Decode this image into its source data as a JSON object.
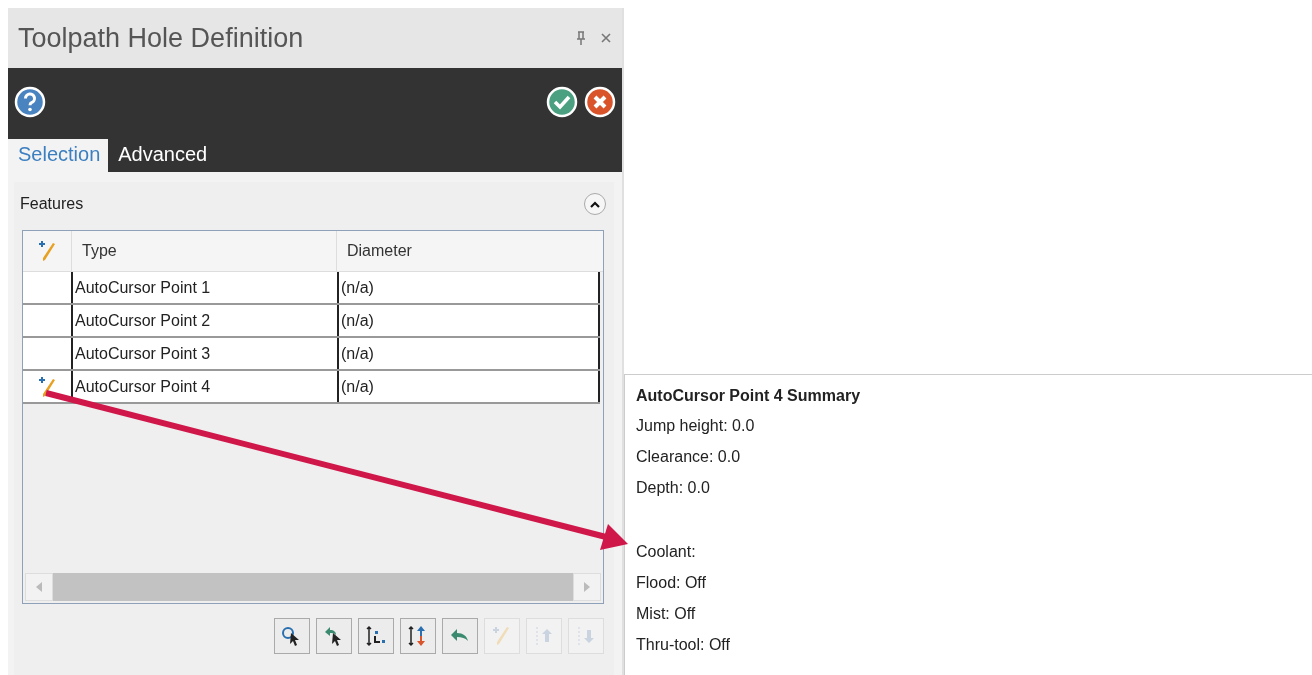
{
  "window": {
    "title": "Toolpath Hole Definition"
  },
  "tabs": [
    {
      "label": "Selection",
      "selected": true
    },
    {
      "label": "Advanced",
      "selected": false
    }
  ],
  "features": {
    "title": "Features",
    "expanded": true,
    "columns": [
      "Type",
      "Diameter"
    ],
    "rows": [
      {
        "type": "AutoCursor Point 1",
        "diameter": "(n/a)",
        "editing": false
      },
      {
        "type": "AutoCursor Point 2",
        "diameter": "(n/a)",
        "editing": false
      },
      {
        "type": "AutoCursor Point 3",
        "diameter": "(n/a)",
        "editing": false
      },
      {
        "type": "AutoCursor Point 4",
        "diameter": "(n/a)",
        "editing": true
      }
    ]
  },
  "toolbar": [
    {
      "kind": "select",
      "disabled": false
    },
    {
      "kind": "deselect",
      "disabled": false
    },
    {
      "kind": "order",
      "disabled": false
    },
    {
      "kind": "reverse",
      "disabled": false
    },
    {
      "kind": "undo",
      "disabled": false
    },
    {
      "kind": "edit",
      "disabled": true
    },
    {
      "kind": "up",
      "disabled": true
    },
    {
      "kind": "down",
      "disabled": true
    }
  ],
  "tooltip": {
    "title": "AutoCursor Point 4 Summary",
    "sections": [
      [
        "Jump height: 0.0",
        "Clearance: 0.0",
        "Depth: 0.0"
      ],
      [
        "Coolant:",
        "Flood: Off",
        "Mist: Off",
        "Thru-tool: Off"
      ]
    ]
  }
}
